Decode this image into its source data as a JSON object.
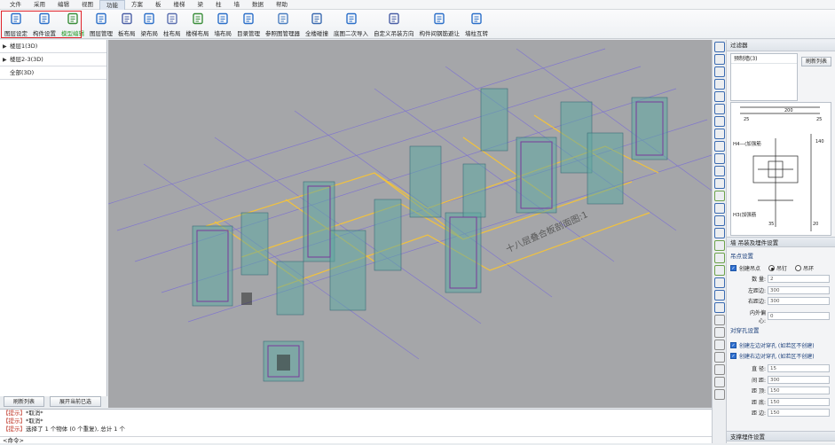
{
  "menu": [
    "文件",
    "采用",
    "编辑",
    "视图",
    "功能",
    "方案",
    "板",
    "楼梯",
    "梁",
    "柱",
    "墙",
    "数据",
    "帮助"
  ],
  "menu_active_index": 4,
  "ribbon": [
    {
      "label": "图层设定",
      "icon": "layer-settings-icon"
    },
    {
      "label": "构件设置",
      "icon": "component-settings-icon"
    },
    {
      "label": "模型编辑",
      "icon": "model-edit-icon",
      "highlight": true
    },
    {
      "label": "图层管理",
      "icon": "layer-manage-icon"
    },
    {
      "label": "板布局",
      "icon": "slab-layout-icon"
    },
    {
      "label": "梁布局",
      "icon": "beam-layout-icon"
    },
    {
      "label": "柱布局",
      "icon": "column-layout-icon"
    },
    {
      "label": "楼梯布局",
      "icon": "stair-layout-icon"
    },
    {
      "label": "墙布局",
      "icon": "wall-layout-icon"
    },
    {
      "label": "目录管理",
      "icon": "catalog-icon"
    },
    {
      "label": "参照图管理器",
      "icon": "reference-icon"
    },
    {
      "label": "全楼碰撞",
      "icon": "collision-icon"
    },
    {
      "label": "底图二次导入",
      "icon": "reimport-icon"
    },
    {
      "label": "自定义吊装方向",
      "icon": "hoist-direction-icon"
    },
    {
      "label": "构件间钢筋避让",
      "icon": "rebar-avoid-icon"
    },
    {
      "label": "墙柱互转",
      "icon": "wall-column-convert-icon"
    }
  ],
  "tree": [
    {
      "label": "楼层1(3D)",
      "arrow": "▶"
    },
    {
      "label": "楼层2-3(3D)",
      "arrow": "▶"
    },
    {
      "label": "全部(3D)",
      "arrow": ""
    }
  ],
  "left_buttons": {
    "refresh": "刷新列表",
    "expand": "展开当前已选"
  },
  "right": {
    "filter_title": "过滤器",
    "filter_items": [
      "预制墙(3)"
    ],
    "refresh": "刷新列表",
    "drawing_labels": {
      "h4": "H4—(加强筋",
      "h3": "H3(加强筋",
      "d200": "200",
      "d25a": "25",
      "d25b": "25",
      "d140": "140",
      "d35": "35",
      "d20": "20"
    },
    "hoist_title": "墙 吊装及埋件设置",
    "hoist_sub": "吊点设置",
    "create_hoist": "创建吊点",
    "radio_ring": "吊钉",
    "radio_lug": "吊环",
    "fields1": [
      {
        "label": "数 量:",
        "value": "2"
      },
      {
        "label": "左距边:",
        "value": "300"
      },
      {
        "label": "右距边:",
        "value": "300"
      },
      {
        "label": "内外偏心:",
        "value": "0"
      }
    ],
    "hole_sub": "对穿孔设置",
    "cb_left": "创建左边对穿孔 (如若区不创建)",
    "cb_right": "创建右边对穿孔 (如若区不创建)",
    "fields2": [
      {
        "label": "直 径:",
        "value": "15"
      },
      {
        "label": "间 距:",
        "value": "300"
      },
      {
        "label": "距 顶:",
        "value": "150"
      },
      {
        "label": "距 底:",
        "value": "150"
      },
      {
        "label": "距 边:",
        "value": "150"
      }
    ],
    "support_title": "支撑埋件设置"
  },
  "console": {
    "lines": [
      {
        "tag": "【提示】",
        "text": "*取消*"
      },
      {
        "tag": "【提示】",
        "text": "*取消*"
      },
      {
        "tag": "【提示】",
        "text": "选择了 1 个物体 (0 个重复), 总计 1 个"
      }
    ],
    "prompt": "<命令>"
  },
  "viewport_text": "十八层叠合板剖面图:1"
}
